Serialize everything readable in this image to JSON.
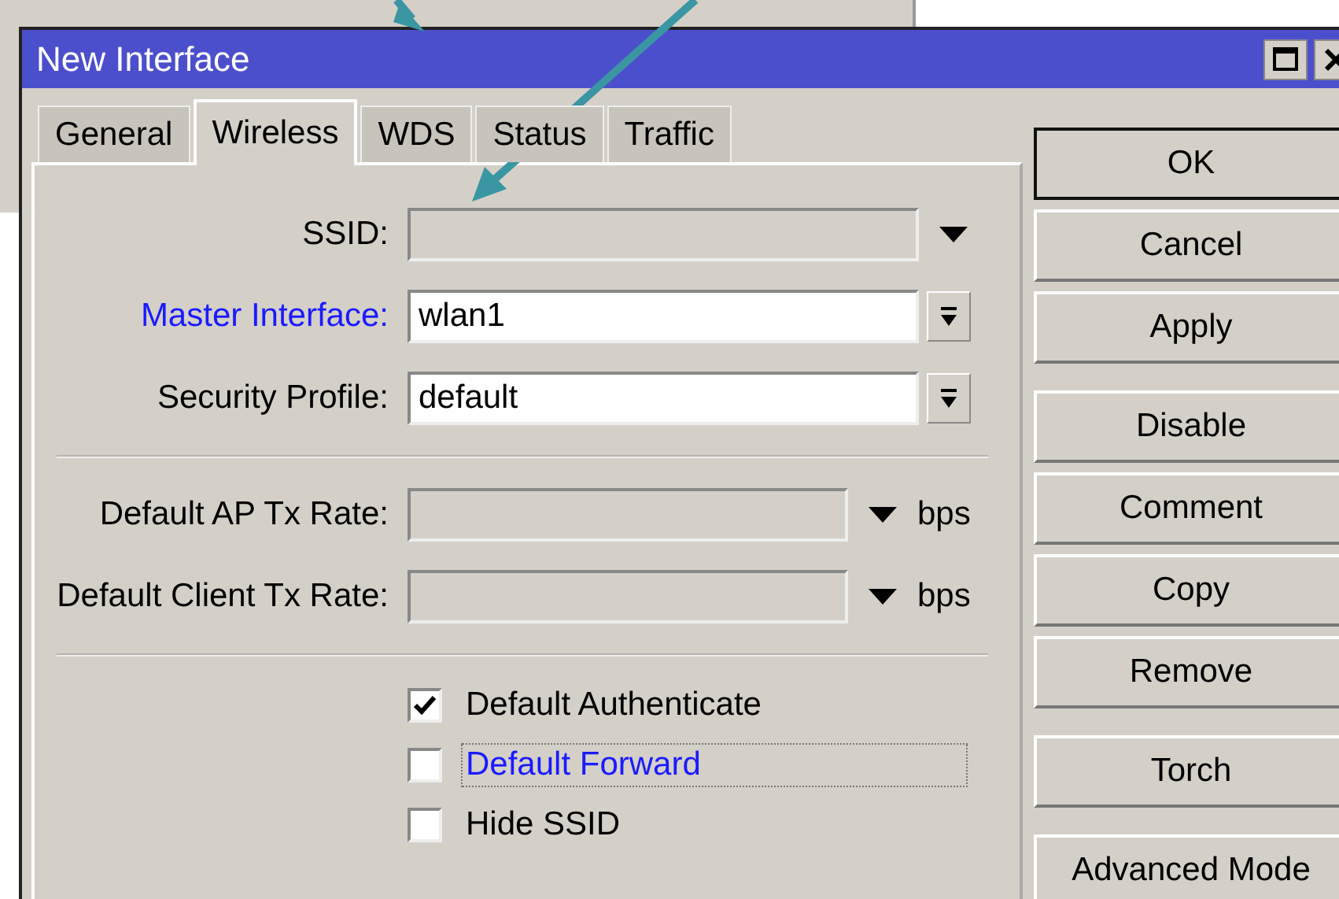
{
  "window": {
    "title": "New Interface"
  },
  "tabs": [
    {
      "label": "General",
      "selected": false
    },
    {
      "label": "Wireless",
      "selected": true
    },
    {
      "label": "WDS",
      "selected": false
    },
    {
      "label": "Status",
      "selected": false
    },
    {
      "label": "Traffic",
      "selected": false
    }
  ],
  "fields": [
    {
      "label": "SSID:",
      "kind": "combo",
      "highlighted": false,
      "enabled": false
    },
    {
      "label": "Master Interface:",
      "kind": "select",
      "value": "wlan1",
      "highlighted": true,
      "enabled": true
    },
    {
      "label": "Security Profile:",
      "kind": "select",
      "value": "default",
      "highlighted": false,
      "enabled": true
    }
  ],
  "rates": [
    {
      "label": "Default AP Tx Rate:",
      "unit": "bps"
    },
    {
      "label": "Default Client Tx Rate:",
      "unit": "bps"
    }
  ],
  "checkboxes": [
    {
      "label": "Default Authenticate",
      "checked": true,
      "highlighted": false,
      "focused": false
    },
    {
      "label": "Default Forward",
      "checked": false,
      "highlighted": true,
      "focused": true
    },
    {
      "label": "Hide SSID",
      "checked": false,
      "highlighted": false,
      "focused": false
    }
  ],
  "button_groups": [
    [
      {
        "label": "OK",
        "default": true
      },
      {
        "label": "Cancel",
        "default": false
      },
      {
        "label": "Apply",
        "default": false
      }
    ],
    [
      {
        "label": "Disable",
        "default": false
      },
      {
        "label": "Comment",
        "default": false
      },
      {
        "label": "Copy",
        "default": false
      },
      {
        "label": "Remove",
        "default": false
      }
    ],
    [
      {
        "label": "Torch",
        "default": false
      }
    ],
    [
      {
        "label": "Advanced Mode",
        "default": false
      }
    ]
  ]
}
